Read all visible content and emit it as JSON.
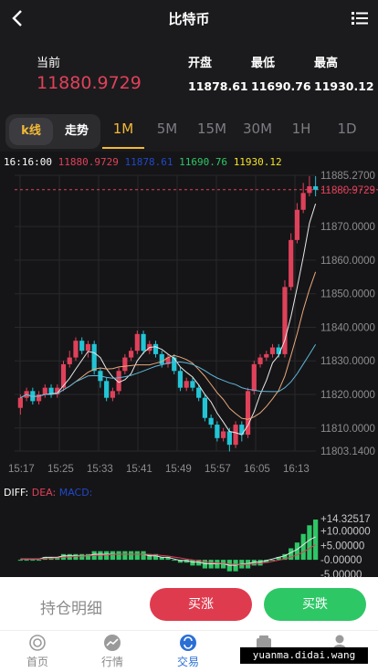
{
  "header": {
    "title": "比特币"
  },
  "quote": {
    "current_label": "当前",
    "current_value": "11880.9729",
    "open_label": "开盘",
    "open_value": "11878.61",
    "low_label": "最低",
    "low_value": "11690.76",
    "high_label": "最高",
    "high_value": "11930.12"
  },
  "tabs": {
    "kline": "k线",
    "trend": "走势",
    "timeframes": [
      "1M",
      "5M",
      "15M",
      "30M",
      "1H",
      "1D"
    ],
    "active": "1M"
  },
  "ohlc": {
    "time": "16:16:00",
    "close": "11880.9729",
    "open": "11878.61",
    "low": "11690.76",
    "high": "11930.12"
  },
  "macd_legend": {
    "diff": "DIFF:",
    "dea": "DEA:",
    "macd": "MACD:"
  },
  "colors": {
    "up": "#e0415a",
    "down": "#22c5d6",
    "accent": "#f2b937",
    "green": "#2ec766"
  },
  "chart_data": {
    "type": "candlestick",
    "price_axis_labels": [
      "11885.2700",
      "11880.9729",
      "11870.0000",
      "11860.0000",
      "11850.0000",
      "11840.0000",
      "11830.0000",
      "11820.0000",
      "11810.0000",
      "11803.1400"
    ],
    "time_labels": [
      "15:17",
      "15:25",
      "15:33",
      "15:41",
      "15:49",
      "15:57",
      "16:05",
      "16:13"
    ],
    "ylim": [
      11803.14,
      11885.27
    ],
    "current_price": 11880.9729,
    "candles": [
      {
        "o": 11816,
        "c": 11819,
        "h": 11820,
        "l": 11814
      },
      {
        "o": 11819,
        "c": 11821,
        "h": 11822,
        "l": 11818
      },
      {
        "o": 11821,
        "c": 11818,
        "h": 11822,
        "l": 11817
      },
      {
        "o": 11818,
        "c": 11820,
        "h": 11821,
        "l": 11817
      },
      {
        "o": 11820,
        "c": 11822,
        "h": 11823,
        "l": 11819
      },
      {
        "o": 11822,
        "c": 11820,
        "h": 11823,
        "l": 11819
      },
      {
        "o": 11820,
        "c": 11822,
        "h": 11823,
        "l": 11819
      },
      {
        "o": 11822,
        "c": 11829,
        "h": 11830,
        "l": 11821
      },
      {
        "o": 11829,
        "c": 11831,
        "h": 11833,
        "l": 11828
      },
      {
        "o": 11831,
        "c": 11836,
        "h": 11837,
        "l": 11830
      },
      {
        "o": 11836,
        "c": 11833,
        "h": 11837,
        "l": 11832
      },
      {
        "o": 11833,
        "c": 11835,
        "h": 11836,
        "l": 11831
      },
      {
        "o": 11835,
        "c": 11827,
        "h": 11836,
        "l": 11826
      },
      {
        "o": 11827,
        "c": 11824,
        "h": 11828,
        "l": 11822
      },
      {
        "o": 11824,
        "c": 11819,
        "h": 11825,
        "l": 11818
      },
      {
        "o": 11819,
        "c": 11821,
        "h": 11822,
        "l": 11818
      },
      {
        "o": 11821,
        "c": 11827,
        "h": 11828,
        "l": 11820
      },
      {
        "o": 11827,
        "c": 11831,
        "h": 11832,
        "l": 11826
      },
      {
        "o": 11831,
        "c": 11833,
        "h": 11834,
        "l": 11830
      },
      {
        "o": 11833,
        "c": 11838,
        "h": 11839,
        "l": 11832
      },
      {
        "o": 11838,
        "c": 11833,
        "h": 11839,
        "l": 11832
      },
      {
        "o": 11833,
        "c": 11835,
        "h": 11836,
        "l": 11832
      },
      {
        "o": 11835,
        "c": 11832,
        "h": 11836,
        "l": 11831
      },
      {
        "o": 11832,
        "c": 11829,
        "h": 11833,
        "l": 11828
      },
      {
        "o": 11829,
        "c": 11831,
        "h": 11832,
        "l": 11828
      },
      {
        "o": 11831,
        "c": 11827,
        "h": 11832,
        "l": 11826
      },
      {
        "o": 11827,
        "c": 11822,
        "h": 11828,
        "l": 11821
      },
      {
        "o": 11822,
        "c": 11824,
        "h": 11825,
        "l": 11821
      },
      {
        "o": 11824,
        "c": 11822,
        "h": 11825,
        "l": 11821
      },
      {
        "o": 11822,
        "c": 11819,
        "h": 11823,
        "l": 11818
      },
      {
        "o": 11819,
        "c": 11813,
        "h": 11820,
        "l": 11812
      },
      {
        "o": 11813,
        "c": 11811,
        "h": 11814,
        "l": 11810
      },
      {
        "o": 11811,
        "c": 11807,
        "h": 11812,
        "l": 11806
      },
      {
        "o": 11807,
        "c": 11809,
        "h": 11810,
        "l": 11806
      },
      {
        "o": 11809,
        "c": 11805,
        "h": 11810,
        "l": 11803
      },
      {
        "o": 11805,
        "c": 11811,
        "h": 11812,
        "l": 11804
      },
      {
        "o": 11811,
        "c": 11808,
        "h": 11812,
        "l": 11806
      },
      {
        "o": 11808,
        "c": 11821,
        "h": 11822,
        "l": 11807
      },
      {
        "o": 11821,
        "c": 11829,
        "h": 11830,
        "l": 11820
      },
      {
        "o": 11829,
        "c": 11831,
        "h": 11832,
        "l": 11828
      },
      {
        "o": 11831,
        "c": 11832,
        "h": 11833,
        "l": 11830
      },
      {
        "o": 11832,
        "c": 11834,
        "h": 11835,
        "l": 11831
      },
      {
        "o": 11834,
        "c": 11832,
        "h": 11835,
        "l": 11831
      },
      {
        "o": 11832,
        "c": 11852,
        "h": 11854,
        "l": 11831
      },
      {
        "o": 11852,
        "c": 11866,
        "h": 11868,
        "l": 11851
      },
      {
        "o": 11866,
        "c": 11875,
        "h": 11877,
        "l": 11865
      },
      {
        "o": 11875,
        "c": 11880,
        "h": 11883,
        "l": 11874
      },
      {
        "o": 11880,
        "c": 11882,
        "h": 11885,
        "l": 11879
      },
      {
        "o": 11882,
        "c": 11880.9729,
        "h": 11885,
        "l": 11879
      }
    ],
    "macd_axis_labels": [
      "+14.32517",
      "+10.00000",
      "+5.00000",
      "-0.00000",
      "-5.00000"
    ],
    "macd_ylim": [
      -6.0,
      14.32517
    ],
    "macd_hist": [
      0,
      0,
      0,
      0,
      1,
      1,
      1,
      2,
      2,
      2,
      2,
      2,
      3,
      3,
      3,
      3,
      3,
      3,
      3,
      3,
      3,
      2,
      2,
      1,
      1,
      0,
      -1,
      -1,
      -2,
      -2,
      -3,
      -3,
      -3,
      -3,
      -4,
      -4,
      -3,
      -3,
      -2,
      -2,
      -1,
      0,
      1,
      2,
      4,
      6,
      9,
      12,
      14
    ]
  },
  "actions": {
    "hold": "持仓明细",
    "buy_up": "买涨",
    "buy_down": "买跌"
  },
  "nav": [
    {
      "label": "首页",
      "icon": "home-icon"
    },
    {
      "label": "行情",
      "icon": "market-icon"
    },
    {
      "label": "交易",
      "icon": "trade-icon"
    },
    {
      "label": "",
      "icon": "wallet-icon"
    },
    {
      "label": "",
      "icon": "user-icon"
    }
  ],
  "watermark": "yuanma.didai.wang"
}
